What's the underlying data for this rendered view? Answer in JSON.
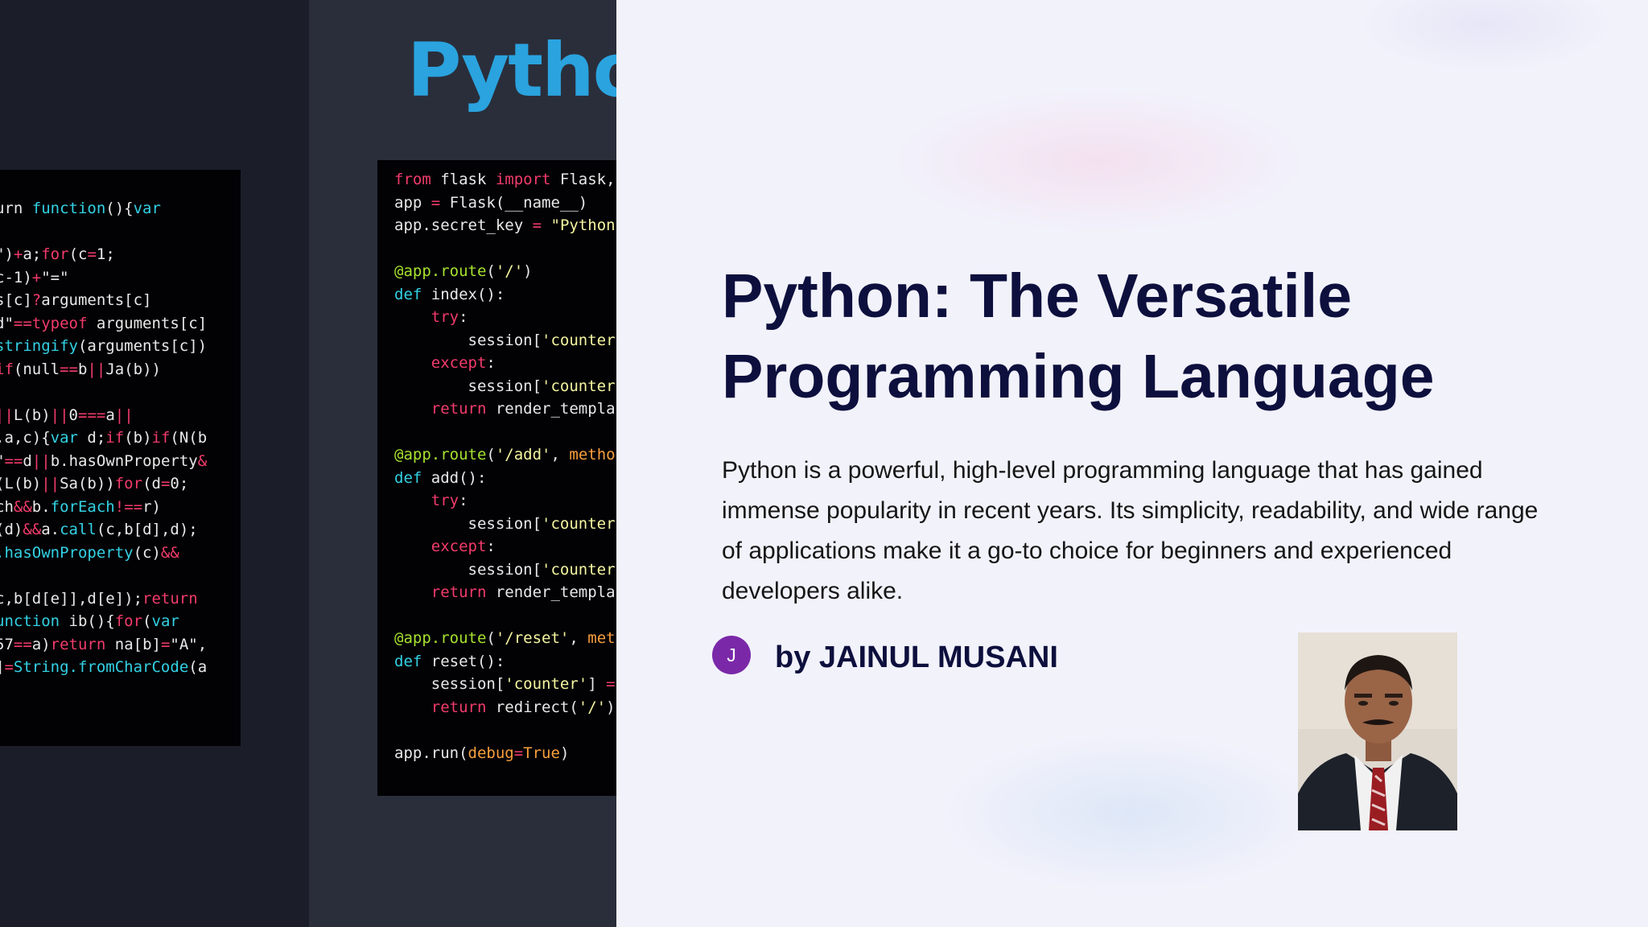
{
  "background_image": {
    "logo_text": "Pytho",
    "js_code_lines": [
      [
        {
          "t": "urn ",
          "c": ""
        },
        {
          "t": "function",
          "c": "fn"
        },
        {
          "t": "(){",
          "c": ""
        },
        {
          "t": "var",
          "c": "fn"
        }
      ],
      [],
      [
        {
          "t": "\")",
          "c": ""
        },
        {
          "t": "+",
          "c": "kw"
        },
        {
          "t": "a;",
          "c": ""
        },
        {
          "t": "for",
          "c": "kw"
        },
        {
          "t": "(c",
          "c": ""
        },
        {
          "t": "=",
          "c": "kw"
        },
        {
          "t": "1;",
          "c": ""
        }
      ],
      [
        {
          "t": "c-1)",
          "c": ""
        },
        {
          "t": "+",
          "c": "kw"
        },
        {
          "t": "\"=\"",
          "c": ""
        }
      ],
      [
        {
          "t": "s[c]",
          "c": ""
        },
        {
          "t": "?",
          "c": "kw"
        },
        {
          "t": "arguments[c]",
          "c": ""
        }
      ],
      [
        {
          "t": "d\"",
          "c": ""
        },
        {
          "t": "==",
          "c": "kw"
        },
        {
          "t": "typeof",
          "c": "kw"
        },
        {
          "t": " arguments[c]",
          "c": ""
        }
      ],
      [
        {
          "t": "stringify",
          "c": "fn"
        },
        {
          "t": "(arguments[c])",
          "c": ""
        }
      ],
      [
        {
          "t": "if",
          "c": "kw"
        },
        {
          "t": "(null",
          "c": ""
        },
        {
          "t": "==",
          "c": "kw"
        },
        {
          "t": "b",
          "c": ""
        },
        {
          "t": "||",
          "c": "kw"
        },
        {
          "t": "Ja(b))",
          "c": ""
        }
      ],
      [],
      [
        {
          "t": "||",
          "c": "kw"
        },
        {
          "t": "L(b)",
          "c": ""
        },
        {
          "t": "||",
          "c": "kw"
        },
        {
          "t": "0",
          "c": ""
        },
        {
          "t": "===",
          "c": "kw"
        },
        {
          "t": "a",
          "c": ""
        },
        {
          "t": "||",
          "c": "kw"
        }
      ],
      [
        {
          "t": ",a,c){",
          "c": ""
        },
        {
          "t": "var",
          "c": "fn"
        },
        {
          "t": " d;",
          "c": ""
        },
        {
          "t": "if",
          "c": "kw"
        },
        {
          "t": "(b)",
          "c": ""
        },
        {
          "t": "if",
          "c": "kw"
        },
        {
          "t": "(N(b",
          "c": ""
        }
      ],
      [
        {
          "t": "\"",
          "c": ""
        },
        {
          "t": "==",
          "c": "kw"
        },
        {
          "t": "d",
          "c": ""
        },
        {
          "t": "||",
          "c": "kw"
        },
        {
          "t": "b.hasOwnProperty",
          "c": ""
        },
        {
          "t": "&",
          "c": "kw"
        }
      ],
      [
        {
          "t": "(L(b)",
          "c": ""
        },
        {
          "t": "||",
          "c": "kw"
        },
        {
          "t": "Sa(b))",
          "c": ""
        },
        {
          "t": "for",
          "c": "kw"
        },
        {
          "t": "(d",
          "c": ""
        },
        {
          "t": "=",
          "c": "kw"
        },
        {
          "t": "0;",
          "c": ""
        }
      ],
      [
        {
          "t": "ch",
          "c": ""
        },
        {
          "t": "&&",
          "c": "kw"
        },
        {
          "t": "b.",
          "c": ""
        },
        {
          "t": "forEach",
          "c": "fn"
        },
        {
          "t": "!",
          "c": "kw"
        },
        {
          "t": "==",
          "c": "kw"
        },
        {
          "t": "r)",
          "c": ""
        }
      ],
      [
        {
          "t": "(d)",
          "c": ""
        },
        {
          "t": "&&",
          "c": "kw"
        },
        {
          "t": "a.",
          "c": ""
        },
        {
          "t": "call",
          "c": "fn"
        },
        {
          "t": "(c,b[d],d);",
          "c": ""
        }
      ],
      [
        {
          "t": ".hasOwnProperty",
          "c": "fn"
        },
        {
          "t": "(c)",
          "c": ""
        },
        {
          "t": "&&",
          "c": "kw"
        }
      ],
      [],
      [
        {
          "t": "c,b[d[e]],d[e]);",
          "c": ""
        },
        {
          "t": "return",
          "c": "kw"
        }
      ],
      [
        {
          "t": "unction",
          "c": "fn"
        },
        {
          "t": " ib(){",
          "c": ""
        },
        {
          "t": "for",
          "c": "kw"
        },
        {
          "t": "(",
          "c": ""
        },
        {
          "t": "var",
          "c": "fn"
        }
      ],
      [
        {
          "t": "57",
          "c": ""
        },
        {
          "t": "==",
          "c": "kw"
        },
        {
          "t": "a)",
          "c": ""
        },
        {
          "t": "return",
          "c": "kw"
        },
        {
          "t": " na[b]",
          "c": ""
        },
        {
          "t": "=",
          "c": "kw"
        },
        {
          "t": "\"A\",",
          "c": ""
        }
      ],
      [
        {
          "t": "]",
          "c": ""
        },
        {
          "t": "=",
          "c": "kw"
        },
        {
          "t": "String.",
          "c": "fn"
        },
        {
          "t": "fromCharCode",
          "c": "fn"
        },
        {
          "t": "(a",
          "c": ""
        }
      ]
    ],
    "py_code_lines": [
      [
        {
          "t": "from",
          "c": "kw"
        },
        {
          "t": " flask ",
          "c": ""
        },
        {
          "t": "import",
          "c": "kw"
        },
        {
          "t": " Flask,",
          "c": ""
        }
      ],
      [
        {
          "t": "app ",
          "c": ""
        },
        {
          "t": "=",
          "c": "kw"
        },
        {
          "t": " Flask(__name__)",
          "c": ""
        }
      ],
      [
        {
          "t": "app.secret_key ",
          "c": ""
        },
        {
          "t": "=",
          "c": "kw"
        },
        {
          "t": " ",
          "c": ""
        },
        {
          "t": "\"Python",
          "c": "st"
        }
      ],
      [],
      [
        {
          "t": "@app.route",
          "c": "dec"
        },
        {
          "t": "(",
          "c": ""
        },
        {
          "t": "'/'",
          "c": "st"
        },
        {
          "t": ")",
          "c": ""
        }
      ],
      [
        {
          "t": "def",
          "c": "fn"
        },
        {
          "t": " index():",
          "c": ""
        }
      ],
      [
        {
          "t": "    ",
          "c": ""
        },
        {
          "t": "try",
          "c": "kw"
        },
        {
          "t": ":",
          "c": ""
        }
      ],
      [
        {
          "t": "        session[",
          "c": ""
        },
        {
          "t": "'counter",
          "c": "st"
        }
      ],
      [
        {
          "t": "    ",
          "c": ""
        },
        {
          "t": "except",
          "c": "kw"
        },
        {
          "t": ":",
          "c": ""
        }
      ],
      [
        {
          "t": "        session[",
          "c": ""
        },
        {
          "t": "'counter",
          "c": "st"
        }
      ],
      [
        {
          "t": "    ",
          "c": ""
        },
        {
          "t": "return",
          "c": "kw"
        },
        {
          "t": " render_templa",
          "c": ""
        }
      ],
      [],
      [
        {
          "t": "@app.route",
          "c": "dec"
        },
        {
          "t": "(",
          "c": ""
        },
        {
          "t": "'/add'",
          "c": "st"
        },
        {
          "t": ", ",
          "c": ""
        },
        {
          "t": "metho",
          "c": "or"
        }
      ],
      [
        {
          "t": "def",
          "c": "fn"
        },
        {
          "t": " add():",
          "c": ""
        }
      ],
      [
        {
          "t": "    ",
          "c": ""
        },
        {
          "t": "try",
          "c": "kw"
        },
        {
          "t": ":",
          "c": ""
        }
      ],
      [
        {
          "t": "        session[",
          "c": ""
        },
        {
          "t": "'counter",
          "c": "st"
        }
      ],
      [
        {
          "t": "    ",
          "c": ""
        },
        {
          "t": "except",
          "c": "kw"
        },
        {
          "t": ":",
          "c": ""
        }
      ],
      [
        {
          "t": "        session[",
          "c": ""
        },
        {
          "t": "'counter",
          "c": "st"
        }
      ],
      [
        {
          "t": "    ",
          "c": ""
        },
        {
          "t": "return",
          "c": "kw"
        },
        {
          "t": " render_templa",
          "c": ""
        }
      ],
      [],
      [
        {
          "t": "@app.route",
          "c": "dec"
        },
        {
          "t": "(",
          "c": ""
        },
        {
          "t": "'/reset'",
          "c": "st"
        },
        {
          "t": ", ",
          "c": ""
        },
        {
          "t": "meth",
          "c": "or"
        }
      ],
      [
        {
          "t": "def",
          "c": "fn"
        },
        {
          "t": " reset():",
          "c": ""
        }
      ],
      [
        {
          "t": "    session[",
          "c": ""
        },
        {
          "t": "'counter'",
          "c": "st"
        },
        {
          "t": "] ",
          "c": ""
        },
        {
          "t": "=",
          "c": "kw"
        }
      ],
      [
        {
          "t": "    ",
          "c": ""
        },
        {
          "t": "return",
          "c": "kw"
        },
        {
          "t": " redirect(",
          "c": ""
        },
        {
          "t": "'/'",
          "c": "st"
        },
        {
          "t": ")",
          "c": ""
        }
      ],
      [],
      [
        {
          "t": "app.run(",
          "c": ""
        },
        {
          "t": "debug",
          "c": "or"
        },
        {
          "t": "=",
          "c": "kw"
        },
        {
          "t": "True",
          "c": "or"
        },
        {
          "t": ")",
          "c": ""
        }
      ]
    ]
  },
  "slide": {
    "title_line1": "Python: The Versatile",
    "title_line2": "Programming Language",
    "description": "Python is a powerful, high-level programming language that has gained immense popularity in recent years. Its simplicity, readability, and wide range of applications make it a go-to choice for beginners and experienced developers alike."
  },
  "author": {
    "avatar_initial": "J",
    "byline": "by JAINUL MUSANI"
  },
  "colors": {
    "title": "#0d0f3d",
    "avatar": "#7a28a8",
    "python_logo": "#2aa3df",
    "panel_background": "#f2f2fb"
  }
}
